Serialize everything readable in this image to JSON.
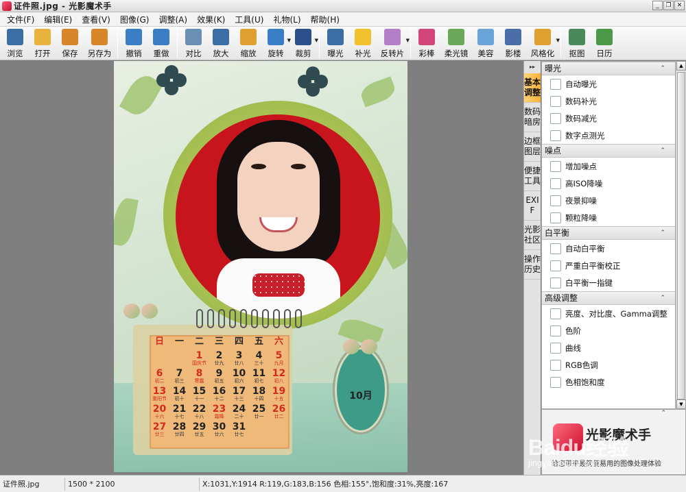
{
  "title": "证件照.jpg - 光影魔术手",
  "window_controls": [
    "_",
    "❐",
    "✕"
  ],
  "menu": [
    "文件(F)",
    "编辑(E)",
    "查看(V)",
    "图像(G)",
    "调整(A)",
    "效果(K)",
    "工具(U)",
    "礼物(L)",
    "帮助(H)"
  ],
  "toolbar": [
    {
      "label": "浏览",
      "icon": "browse-icon",
      "color": "#3a6ea5"
    },
    {
      "label": "打开",
      "icon": "folder-open-icon",
      "color": "#e8b23c"
    },
    {
      "label": "保存",
      "icon": "save-icon",
      "color": "#d9862a"
    },
    {
      "label": "另存为",
      "icon": "save-as-icon",
      "color": "#d9862a"
    },
    {
      "label": "撤销",
      "icon": "undo-icon",
      "color": "#3a7fc6"
    },
    {
      "label": "重做",
      "icon": "redo-icon",
      "color": "#3a7fc6"
    },
    {
      "label": "对比",
      "icon": "compare-icon",
      "color": "#6a8fb5"
    },
    {
      "label": "放大",
      "icon": "zoom-in-icon",
      "color": "#3a6ea5"
    },
    {
      "label": "缩放",
      "icon": "resize-icon",
      "color": "#e0a030"
    },
    {
      "label": "旋转",
      "icon": "rotate-icon",
      "color": "#3a7fc6"
    },
    {
      "label": "裁剪",
      "icon": "crop-icon",
      "color": "#2a4f8a"
    },
    {
      "label": "曝光",
      "icon": "exposure-icon",
      "color": "#3a6ea5"
    },
    {
      "label": "补光",
      "icon": "fill-light-icon",
      "color": "#f2c12e"
    },
    {
      "label": "反转片",
      "icon": "reversal-film-icon",
      "color": "#b27ec8"
    },
    {
      "label": "彩棒",
      "icon": "color-wand-icon",
      "color": "#d2447a"
    },
    {
      "label": "柔光镜",
      "icon": "soft-lens-icon",
      "color": "#6aa85a"
    },
    {
      "label": "美容",
      "icon": "beauty-icon",
      "color": "#6aa3d8"
    },
    {
      "label": "影楼",
      "icon": "studio-icon",
      "color": "#4a6ea8"
    },
    {
      "label": "风格化",
      "icon": "stylize-icon",
      "color": "#e0a030"
    },
    {
      "label": "抠图",
      "icon": "cutout-icon",
      "color": "#4a8a5a"
    },
    {
      "label": "日历",
      "icon": "calendar-icon",
      "color": "#4a9a4a"
    }
  ],
  "side_tabs": [
    "基本调整",
    "数码暗房",
    "边框图层",
    "便捷工具",
    "EXIF",
    "光影社区",
    "操作历史"
  ],
  "panel": [
    {
      "header": "曝光",
      "items": [
        {
          "label": "自动曝光",
          "icon": "auto-exposure-icon"
        },
        {
          "label": "数码补光",
          "icon": "digital-fill-light-icon"
        },
        {
          "label": "数码减光",
          "icon": "digital-reduce-light-icon"
        },
        {
          "label": "数字点测光",
          "icon": "spot-metering-icon"
        }
      ]
    },
    {
      "header": "噪点",
      "items": [
        {
          "label": "增加噪点",
          "icon": "add-noise-icon"
        },
        {
          "label": "高ISO降噪",
          "icon": "iso-denoise-icon"
        },
        {
          "label": "夜景抑噪",
          "icon": "night-denoise-icon"
        },
        {
          "label": "颗粒降噪",
          "icon": "grain-denoise-icon"
        }
      ]
    },
    {
      "header": "白平衡",
      "items": [
        {
          "label": "自动白平衡",
          "icon": "auto-wb-icon"
        },
        {
          "label": "严重白平衡校正",
          "icon": "wb-correction-icon"
        },
        {
          "label": "白平衡一指键",
          "icon": "wb-one-click-icon"
        }
      ]
    },
    {
      "header": "高级调整",
      "items": [
        {
          "label": "亮度、对比度、Gamma调整",
          "icon": "brightness-icon"
        },
        {
          "label": "色阶",
          "icon": "levels-icon"
        },
        {
          "label": "曲线",
          "icon": "curves-icon"
        },
        {
          "label": "RGB色调",
          "icon": "rgb-icon"
        },
        {
          "label": "色相饱和度",
          "icon": "hue-saturation-icon"
        }
      ]
    }
  ],
  "calendar": {
    "weekdays": [
      "日",
      "一",
      "二",
      "三",
      "四",
      "五",
      "六"
    ],
    "month_label": "10月",
    "weeks": [
      [
        null,
        null,
        {
          "d": "1",
          "l": "国庆节",
          "r": true
        },
        {
          "d": "2",
          "l": "廿九"
        },
        {
          "d": "3",
          "l": "廿八"
        },
        {
          "d": "4",
          "l": "三十"
        },
        {
          "d": "5",
          "l": "九月",
          "r": true
        }
      ],
      [
        {
          "d": "6",
          "l": "初二",
          "r": true
        },
        {
          "d": "7",
          "l": "初三"
        },
        {
          "d": "8",
          "l": "寒露",
          "r": true
        },
        {
          "d": "9",
          "l": "初五"
        },
        {
          "d": "10",
          "l": "初六"
        },
        {
          "d": "11",
          "l": "初七"
        },
        {
          "d": "12",
          "l": "初八",
          "r": true
        }
      ],
      [
        {
          "d": "13",
          "l": "重阳节",
          "r": true
        },
        {
          "d": "14",
          "l": "初十"
        },
        {
          "d": "15",
          "l": "十一"
        },
        {
          "d": "16",
          "l": "十二"
        },
        {
          "d": "17",
          "l": "十三"
        },
        {
          "d": "18",
          "l": "十四"
        },
        {
          "d": "19",
          "l": "十五",
          "r": true
        }
      ],
      [
        {
          "d": "20",
          "l": "十六",
          "r": true
        },
        {
          "d": "21",
          "l": "十七"
        },
        {
          "d": "22",
          "l": "十八"
        },
        {
          "d": "23",
          "l": "霜降",
          "r": true
        },
        {
          "d": "24",
          "l": "二十"
        },
        {
          "d": "25",
          "l": "廿一"
        },
        {
          "d": "26",
          "l": "廿二",
          "r": true
        }
      ],
      [
        {
          "d": "27",
          "l": "廿三",
          "r": true
        },
        {
          "d": "28",
          "l": "廿四"
        },
        {
          "d": "29",
          "l": "廿五"
        },
        {
          "d": "30",
          "l": "廿六"
        },
        {
          "d": "31",
          "l": "廿七"
        },
        null,
        null
      ]
    ]
  },
  "ad": {
    "title": "光影魔术手",
    "subtitle": "给您带来最简便易用的图像处理体验"
  },
  "watermark": {
    "brand": "Baidu经验",
    "url": "jingyan.baidu.com"
  },
  "statusbar": {
    "filename": "证件照.jpg",
    "dimensions": "1500 * 2100",
    "pixel_info": "X:1031,Y:1914 R:119,G:183,B:156 色相:155°,饱和度:31%,亮度:167"
  }
}
